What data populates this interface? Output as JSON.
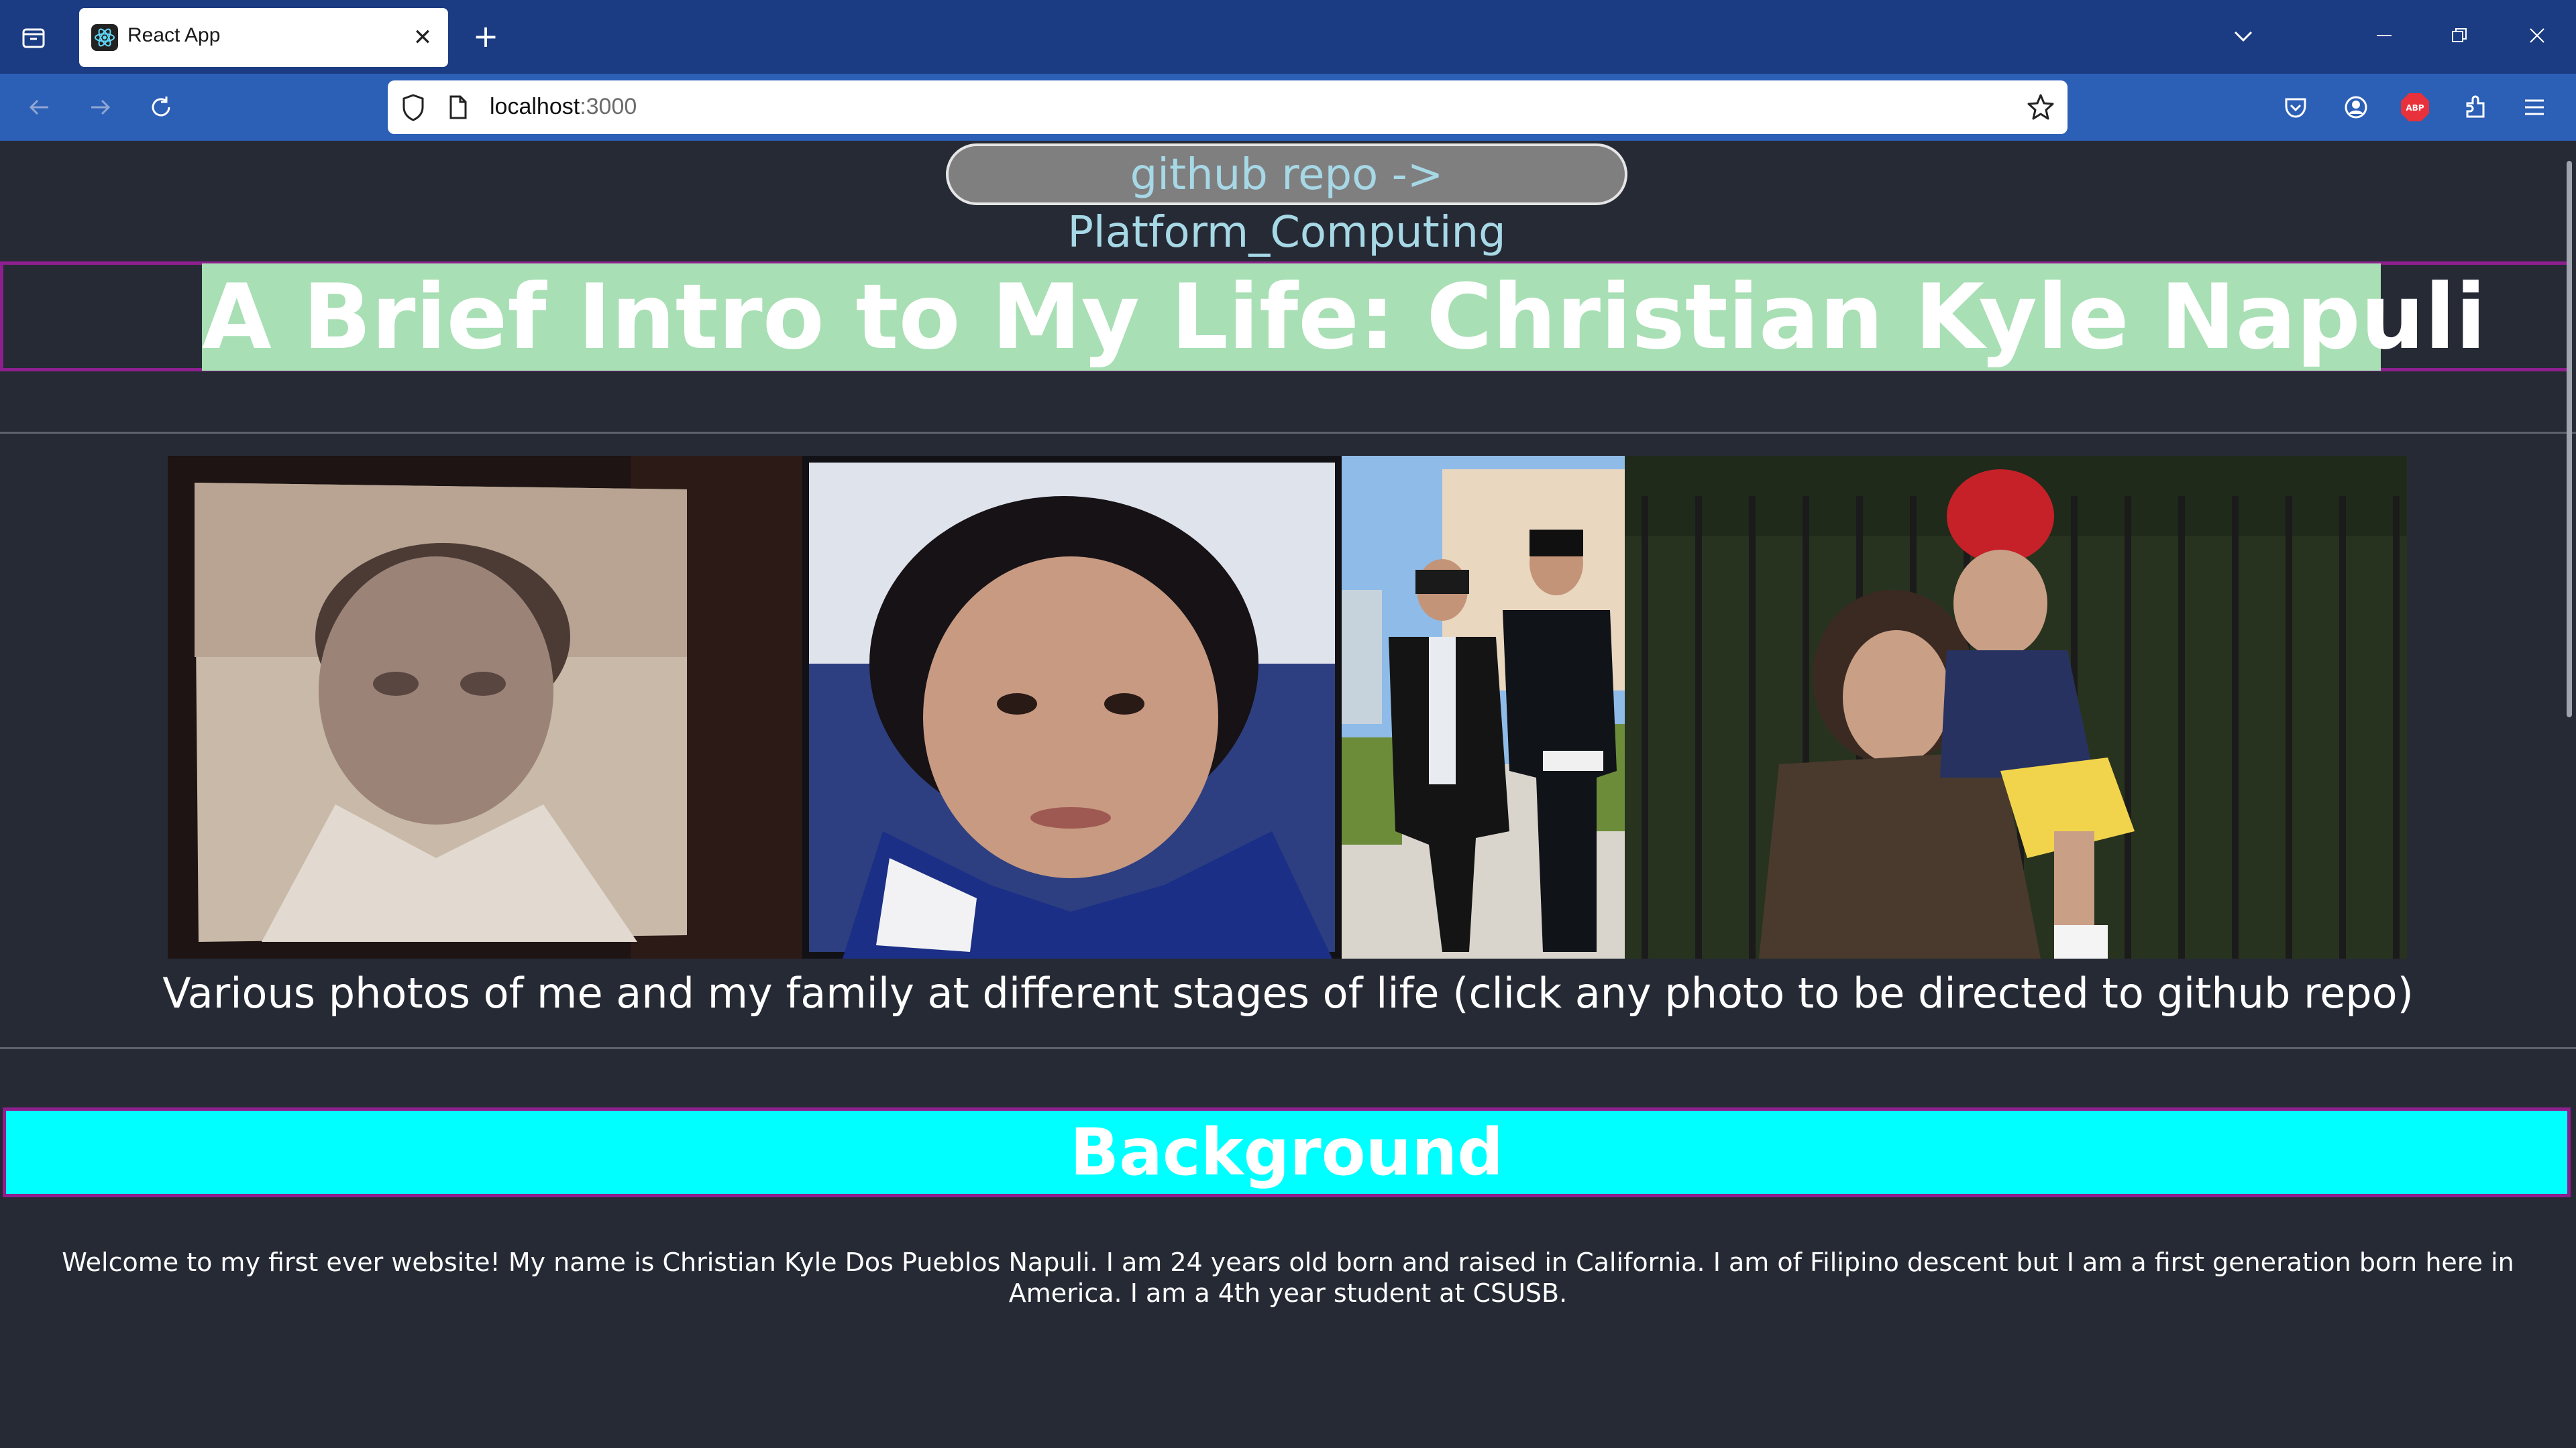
{
  "browser": {
    "tab_title": "React App",
    "url_host": "localhost",
    "url_port": ":3000",
    "icons": [
      "tab-list-icon",
      "react-favicon-icon",
      "close-icon",
      "plus-icon",
      "chevron-down-icon",
      "minimize-icon",
      "restore-icon",
      "close-window-icon",
      "back-arrow-icon",
      "forward-arrow-icon",
      "reload-icon",
      "shield-icon",
      "page-icon",
      "star-icon",
      "pocket-icon",
      "account-icon",
      "adblock-icon",
      "extensions-icon",
      "menu-icon"
    ],
    "adblock_label": "ABP",
    "tab_close": "✕",
    "new_tab": "+"
  },
  "page": {
    "repo_button": "github repo -> Platform_Computing",
    "title": "A Brief Intro to My Life: Christian Kyle Napuli",
    "photo_caption": "Various photos of me and my family at different stages of life (click any photo to be directed to github repo)",
    "background_heading": "Background",
    "background_text": "Welcome to my first ever website! My name is Christian Kyle Dos Pueblos Napuli. I am 24 years old born and raised in California. I am of Filipino descent but I am a first generation born here in America. I am a 4th year student at CSUSB."
  },
  "colors": {
    "page_bg": "#262a35",
    "title_bg": "#a8dfb4",
    "heading_bg": "#00ffff",
    "border_accent": "#8e1f8e",
    "repo_text": "#a7d8e6"
  }
}
